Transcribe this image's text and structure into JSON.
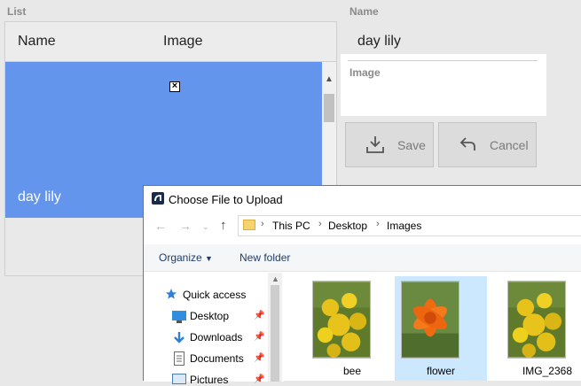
{
  "app": {
    "list_label": "List",
    "name_label": "Name",
    "list": {
      "columns": [
        "Name",
        "Image"
      ],
      "rows": [
        {
          "name": "day lily",
          "image": "broken-image-icon"
        }
      ]
    },
    "form": {
      "name_value": "day lily",
      "image_label": "Image"
    },
    "buttons": {
      "save_label": "Save",
      "cancel_label": "Cancel"
    }
  },
  "dialog": {
    "title": "Choose File to Upload",
    "address": [
      "This PC",
      "Desktop",
      "Images"
    ],
    "toolbar": {
      "organize_label": "Organize",
      "new_folder_label": "New folder"
    },
    "nav_items": [
      {
        "label": "Quick access",
        "icon": "star-icon"
      },
      {
        "label": "Desktop",
        "icon": "desktop-icon"
      },
      {
        "label": "Downloads",
        "icon": "download-icon"
      },
      {
        "label": "Documents",
        "icon": "document-icon"
      },
      {
        "label": "Pictures",
        "icon": "pictures-icon"
      }
    ],
    "files": [
      {
        "name": "bee",
        "selected": false
      },
      {
        "name": "flower",
        "selected": true
      },
      {
        "name": "IMG_2368",
        "selected": false
      }
    ]
  },
  "colors": {
    "selected_row": "#6495ed",
    "dialog_accent": "#3b7fd1",
    "file_selected": "#cce8ff"
  }
}
